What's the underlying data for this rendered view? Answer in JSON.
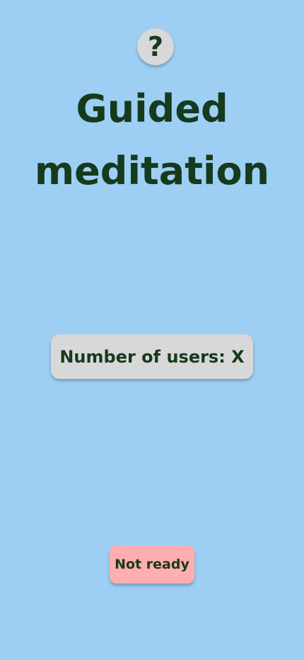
{
  "help": {
    "label": "?",
    "icon": "question-mark-icon"
  },
  "title": {
    "line1": "Guided",
    "line2": "meditation"
  },
  "users": {
    "label": "Number of users: X"
  },
  "status": {
    "label": "Not ready"
  },
  "colors": {
    "background": "#9dcff5",
    "text": "#163a1c",
    "neutral": "#d8d8d8",
    "notReady": "#ffaeb0"
  }
}
